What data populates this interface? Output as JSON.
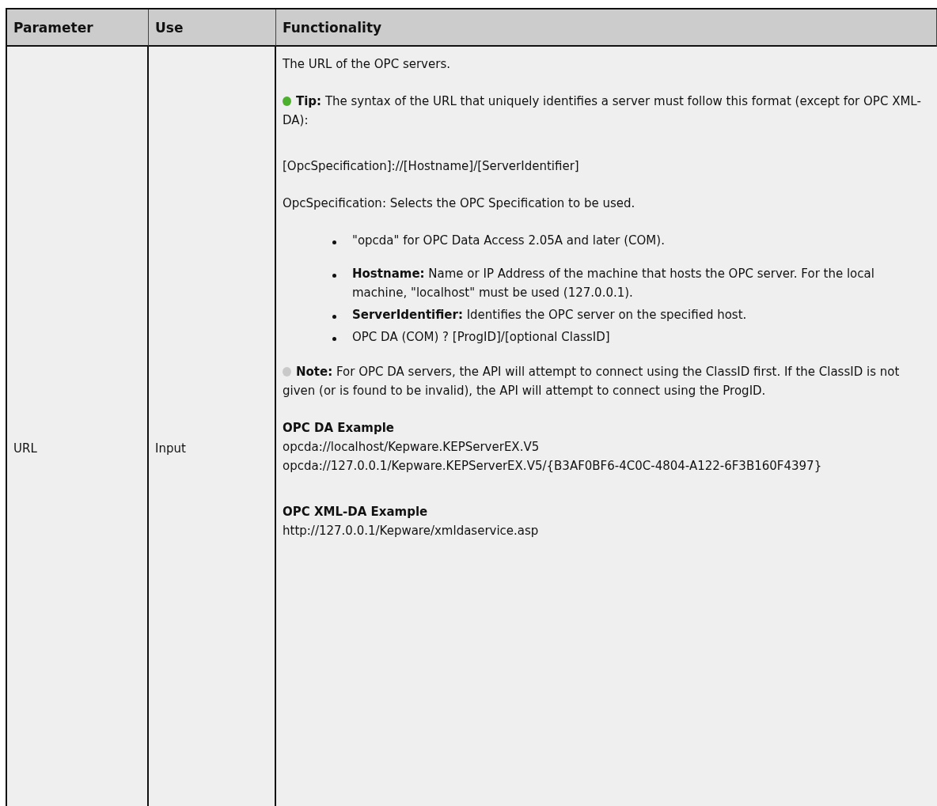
{
  "table": {
    "columns": [
      "Parameter",
      "Use",
      "Functionality"
    ],
    "rows": [
      {
        "parameter": "URL",
        "use": "Input",
        "functionality": [
          {
            "kind": "paragraph",
            "text": "The URL of the OPC servers."
          },
          {
            "kind": "tip",
            "text": "**Tip:** The syntax of the URL that uniquely identifies a server must follow this format (except for OPC XML-DA):"
          },
          {
            "kind": "paragraph",
            "text": "[OpcSpecification]://[Hostname]/[ServerIdentifier]"
          },
          {
            "kind": "paragraph",
            "text": "OpcSpecification: Selects the OPC Specification to be used."
          },
          {
            "kind": "bullets",
            "items": [
              "\"opcda\" for OPC Data Access 2.05A and later (COM).",
              "**Hostname:** Name or IP Address of the machine that hosts the OPC server. For the local machine, \"localhost\" must be used (127.0.0.1).",
              "**ServerIdentifier:** Identifies the OPC server on the specified host.",
              "OPC DA (COM) ? [ProgID]/[optional ClassID]"
            ]
          },
          {
            "kind": "note",
            "text": "**Note:** For OPC DA servers, the API will attempt to connect using the ClassID first. If the ClassID is not given (or is found to be invalid), the API will attempt to connect using the ProgID."
          },
          {
            "kind": "heading",
            "text": "OPC DA Example"
          },
          {
            "kind": "line",
            "text": "opcda://localhost/Kepware.KEPServerEX.V5"
          },
          {
            "kind": "line",
            "text": "opcda://127.0.0.1/Kepware.KEPServerEX.V5/{B3AF0BF6-4C0C-4804-A122-6F3B160F4397}"
          },
          {
            "kind": "heading",
            "text": "OPC XML-DA Example"
          },
          {
            "kind": "line",
            "text": "http://127.0.0.1/Kepware/xmldaservice.asp"
          }
        ]
      }
    ]
  }
}
